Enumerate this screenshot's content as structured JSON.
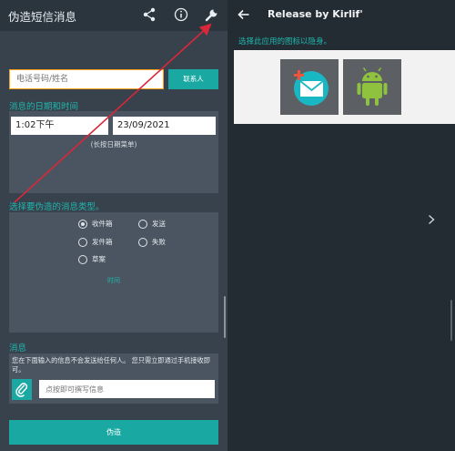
{
  "left_app": {
    "title": "伪造短信消息",
    "icons": [
      "share-icon",
      "info-icon",
      "wrench-icon"
    ]
  },
  "recipient": {
    "placeholder": "电话号码/姓名",
    "contact_button": "联系人"
  },
  "datetime": {
    "label": "消息的日期和时间",
    "time_value": "1:02下午",
    "date_value": "23/09/2021",
    "hint": "(长按日期菜单)"
  },
  "message_type": {
    "label": "选择要伪造的消息类型。",
    "options": [
      {
        "label": "收件箱",
        "checked": true
      },
      {
        "label": "发送",
        "checked": false
      },
      {
        "label": "发件箱",
        "checked": false
      },
      {
        "label": "失败",
        "checked": false
      },
      {
        "label": "草案",
        "checked": false
      }
    ],
    "link_text": "时间"
  },
  "message": {
    "label": "消息",
    "note": "您在下面输入的信息不会发送给任何人。 您只需立即通过手机接收即可。",
    "input_placeholder": "点按即可撰写信息"
  },
  "fake_button": "伪造",
  "right_app": {
    "title": "Release by Kirlif'",
    "hide_label": "选择此应用的图标以隐身。",
    "icon_tiles": [
      "message-app-icon",
      "android-icon"
    ]
  },
  "colors": {
    "accent": "#19a8a2",
    "accent_text": "#1fb6ad",
    "left_bg": "#37424d",
    "right_bg": "#242c33",
    "highlight_border": "#ff9f1c",
    "annotation_arrow": "#d8283a"
  }
}
